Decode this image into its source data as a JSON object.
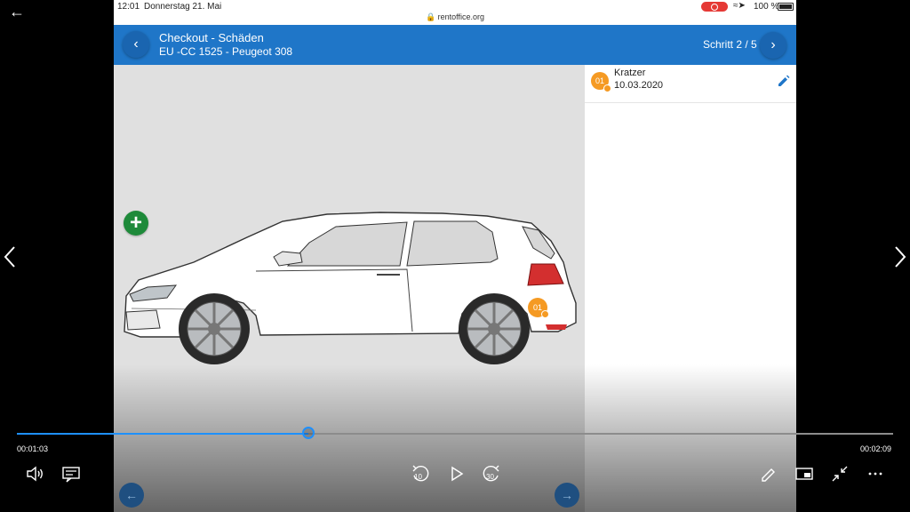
{
  "status_bar": {
    "time": "12:01",
    "date": "Donnerstag 21. Mai",
    "url": "rentoffice.org",
    "battery": "100 %"
  },
  "header": {
    "title": "Checkout - Schäden",
    "subtitle": "EU -CC 1525 - Peugeot 308",
    "step": "Schritt 2 / 5"
  },
  "damage": {
    "marker_number": "01",
    "items": [
      {
        "number": "01",
        "type": "Kratzer",
        "date": "10.03.2020"
      }
    ]
  },
  "video": {
    "current_time": "00:01:03",
    "total_time": "00:02:09",
    "progress_fraction": 0.333,
    "rewind_seconds": "10",
    "forward_seconds": "30"
  },
  "icons": {
    "add": "plus-icon",
    "edit": "pencil-icon",
    "back": "arrow-left-icon",
    "chevron_left": "chevron-left-icon",
    "chevron_right": "chevron-right-icon"
  },
  "colors": {
    "header_blue": "#1f76c8",
    "marker_orange": "#f59a23",
    "add_green": "#1e8a3a",
    "seek_blue": "#1e90ff",
    "record_red": "#e53935"
  }
}
